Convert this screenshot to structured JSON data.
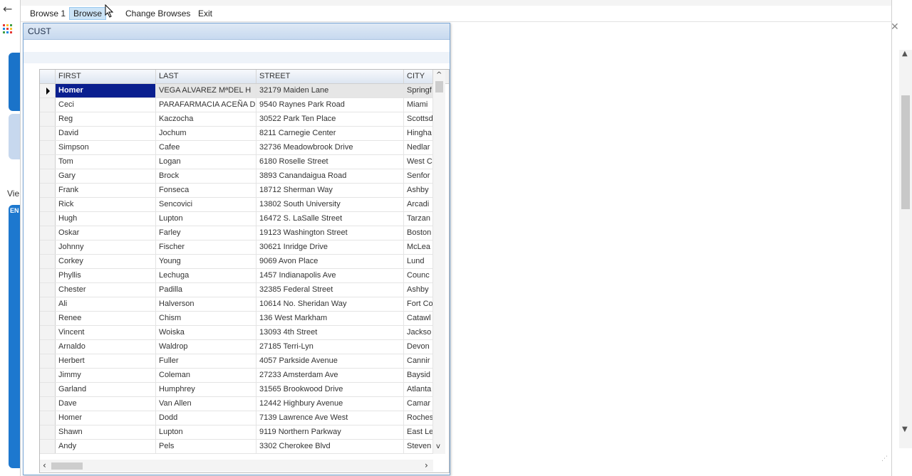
{
  "menu": {
    "items": [
      {
        "label": "Browse 1",
        "active": false
      },
      {
        "label": "Browse",
        "active": true
      },
      {
        "label": "Change Browses",
        "active": false
      },
      {
        "label": "Exit",
        "active": false
      }
    ]
  },
  "background": {
    "partial_label": "Vie",
    "partial_tile_label": "EN"
  },
  "child_window": {
    "title": "CUST"
  },
  "grid": {
    "columns": [
      "FIRST",
      "LAST",
      "STREET",
      "CITY"
    ],
    "current_row": 0,
    "rows": [
      [
        "Homer",
        "VEGA ALVAREZ MªDEL H",
        "32179 Maiden Lane",
        "Springf"
      ],
      [
        "Ceci",
        "PARAFARMACIA ACEÑA D",
        "9540 Raynes Park Road",
        "Miami"
      ],
      [
        "Reg",
        "Kaczocha",
        "30522 Park Ten Place",
        "Scottsd"
      ],
      [
        "David",
        "Jochum",
        "8211 Carnegie Center",
        "Hingha"
      ],
      [
        "Simpson",
        "Cafee",
        "32736 Meadowbrook Drive",
        "Nedlar"
      ],
      [
        "Tom",
        "Logan",
        "6180 Roselle Street",
        "West C"
      ],
      [
        "Gary",
        "Brock",
        "3893 Canandaigua Road",
        "Senfor"
      ],
      [
        "Frank",
        "Fonseca",
        "18712 Sherman Way",
        "Ashby"
      ],
      [
        "Rick",
        "Sencovici",
        "13802 South University",
        "Arcadi"
      ],
      [
        "Hugh",
        "Lupton",
        "16472 S. LaSalle Street",
        "Tarzan"
      ],
      [
        "Oskar",
        "Farley",
        "19123 Washington Street",
        "Boston"
      ],
      [
        "Johnny",
        "Fischer",
        "30621 Inridge Drive",
        "McLea"
      ],
      [
        "Corkey",
        "Young",
        "9069 Avon Place",
        "Lund"
      ],
      [
        "Phyllis",
        "Lechuga",
        "1457 Indianapolis Ave",
        "Counc"
      ],
      [
        "Chester",
        "Padilla",
        "32385 Federal Street",
        "Ashby"
      ],
      [
        "Ali",
        "Halverson",
        "10614 No. Sheridan Way",
        "Fort Co"
      ],
      [
        "Renee",
        "Chism",
        "136 West Markham",
        "Catawl"
      ],
      [
        "Vincent",
        "Woiska",
        "13093 4th Street",
        "Jackso"
      ],
      [
        "Arnaldo",
        "Waldrop",
        "27185 Terri-Lyn",
        "Devon"
      ],
      [
        "Herbert",
        "Fuller",
        "4057 Parkside Avenue",
        "Cannir"
      ],
      [
        "Jimmy",
        "Coleman",
        "27233 Amsterdam Ave",
        "Baysid"
      ],
      [
        "Garland",
        "Humphrey",
        "31565 Brookwood Drive",
        "Atlanta"
      ],
      [
        "Dave",
        "Van Allen",
        "12442 Highbury Avenue",
        "Camar"
      ],
      [
        "Homer",
        "Dodd",
        "7139 Lawrence Ave West",
        "Roches"
      ],
      [
        "Shawn",
        "Lupton",
        "9119 Northern Parkway",
        "East Le"
      ],
      [
        "Andy",
        "Pels",
        "3302 Cherokee Blvd",
        "Steven"
      ]
    ]
  },
  "colors": {
    "selected_cell": "#0a1f8f",
    "menu_active": "#cce4f7",
    "child_title": "#c7d9ef"
  },
  "icons": {
    "back": "back-arrow-icon",
    "apps": "apps-grid-icon",
    "close": "close-icon",
    "row_pointer": "row-pointer-icon",
    "cursor": "mouse-cursor-icon"
  }
}
